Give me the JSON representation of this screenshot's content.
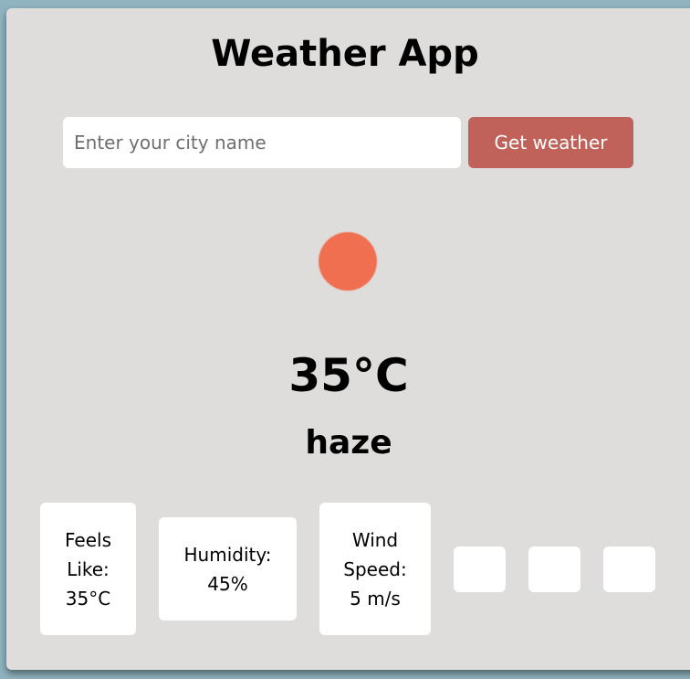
{
  "app": {
    "title": "Weather App"
  },
  "search": {
    "placeholder": "Enter your city name",
    "value": "",
    "button_label": "Get weather"
  },
  "current": {
    "icon": "sun-icon",
    "icon_color": "#ef6f50",
    "temperature": "35°C",
    "description": "haze"
  },
  "details": {
    "feels_like": {
      "line1": "Feels",
      "line2": "Like:",
      "line3": "35°C"
    },
    "humidity": {
      "line1": "Humidity:",
      "line2": "45%"
    },
    "wind": {
      "line1": "Wind",
      "line2": "Speed:",
      "line3": "5 m/s"
    }
  },
  "colors": {
    "background": "#8fb3bf",
    "card": "#dfdddc",
    "button": "#c0625a"
  }
}
